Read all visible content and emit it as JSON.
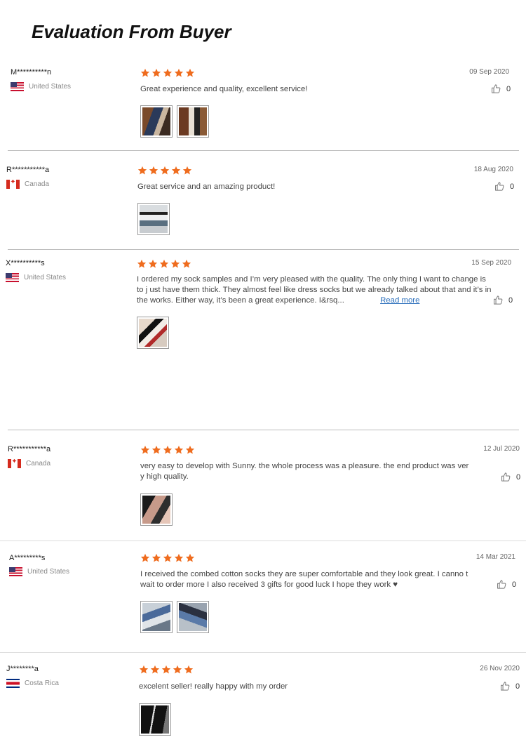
{
  "page_title": "Evaluation From Buyer",
  "colors": {
    "star": "#ef6c1e",
    "link": "#2a6ebb"
  },
  "reviews": [
    {
      "name": "M**********n",
      "country": "United States",
      "flag": "us",
      "date": "09 Sep 2020",
      "text": "Great experience and quality, excellent service!",
      "likes": "0"
    },
    {
      "name": "R***********a",
      "country": "Canada",
      "flag": "ca",
      "date": "18 Aug 2020",
      "text": "Great service and an amazing product!",
      "likes": "0"
    },
    {
      "name": "X**********s",
      "country": "United States",
      "flag": "us",
      "date": "15 Sep 2020",
      "text": "I ordered my sock samples and I’m very pleased with the quality. The only thing I want to change is to j ust have them thick. They almost feel like dress socks but we already talked about that and it’s in the works. Either way, it’s been a great experience. I&rsq...",
      "read_more": "Read more",
      "likes": "0"
    },
    {
      "name": "R***********a",
      "country": "Canada",
      "flag": "ca",
      "date": "12 Jul 2020",
      "text": "very easy to develop with Sunny. the whole process was a pleasure. the end product was ver y high quality.",
      "likes": "0"
    },
    {
      "name": "A*********s",
      "country": "United States",
      "flag": "us",
      "date": "14 Mar 2021",
      "text": "I received the combed cotton socks they are super comfortable and they look great. I canno t wait to order more I also received 3 gifts for good luck I hope they work ♥",
      "likes": "0"
    },
    {
      "name": "J********a",
      "country": "Costa Rica",
      "flag": "cr",
      "date": "26 Nov 2020",
      "text": "excelent seller! really happy with my order",
      "likes": "0"
    }
  ]
}
